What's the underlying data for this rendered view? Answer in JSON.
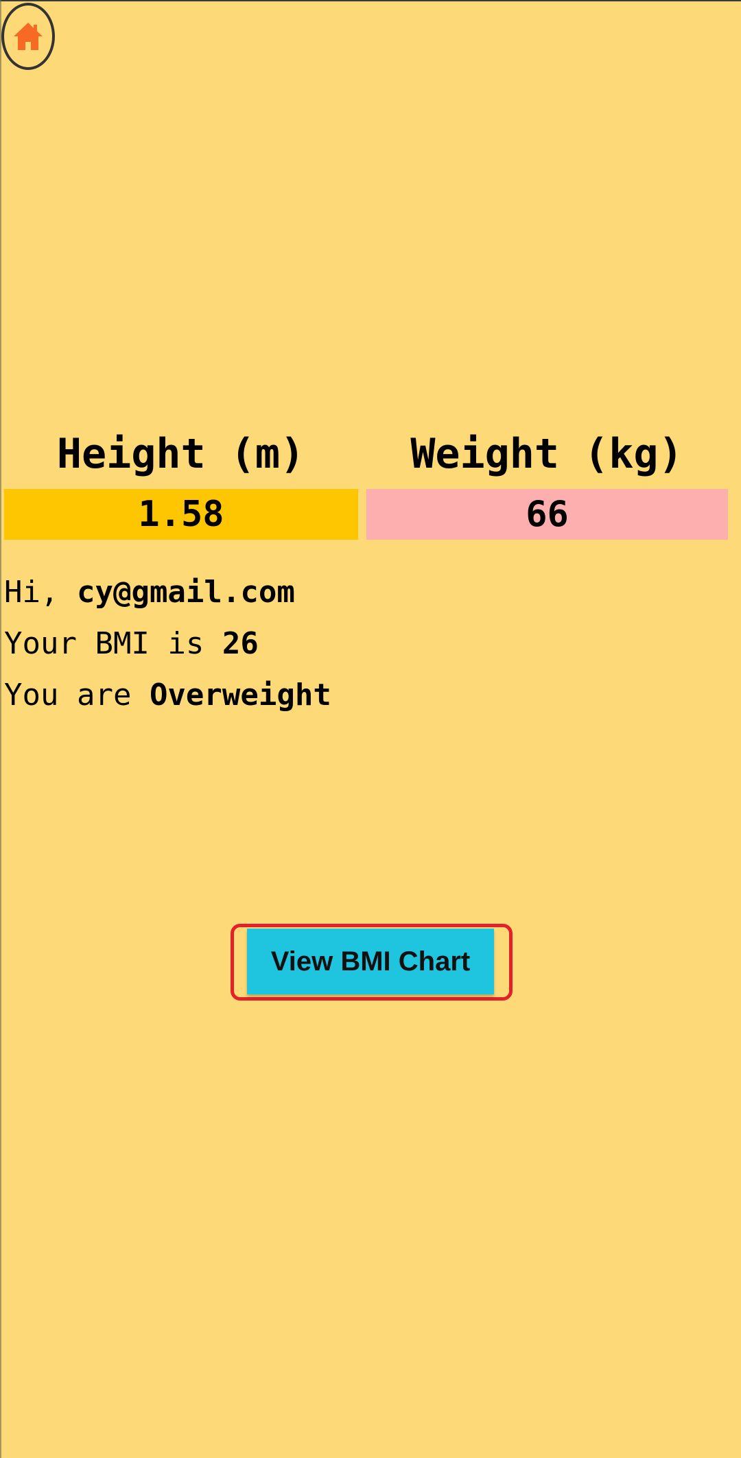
{
  "header": {
    "home_icon": "home-icon"
  },
  "measurements": {
    "height_label": "Height (m)",
    "weight_label": "Weight (kg)",
    "height_value": "1.58",
    "weight_value": "66"
  },
  "result": {
    "greeting_prefix": "Hi,",
    "email": "cy@gmail.com",
    "bmi_prefix": "Your BMI is",
    "bmi_value": "26",
    "status_prefix": "You are",
    "status_value": "Overweight"
  },
  "actions": {
    "view_chart_label": "View BMI Chart"
  },
  "colors": {
    "background": "#FED977",
    "height_box": "#FEC600",
    "weight_box": "#FDAFAF",
    "button": "#1FC4DE",
    "highlight": "#E4202A",
    "home_icon": "#F76A26"
  }
}
